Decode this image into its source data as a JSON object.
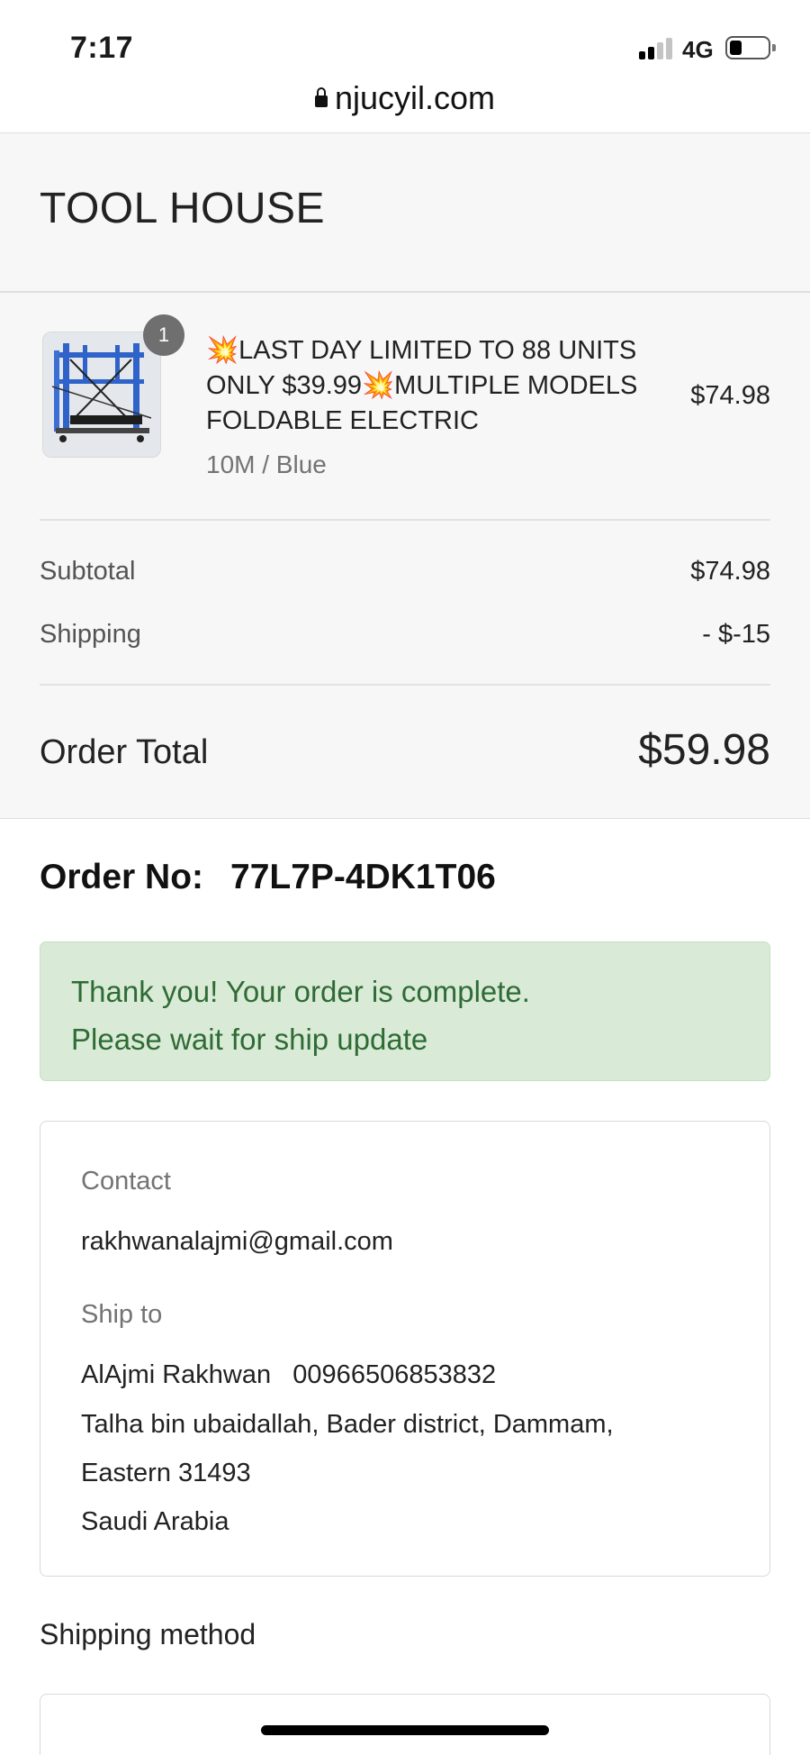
{
  "status_bar": {
    "time": "7:17",
    "network": "4G"
  },
  "browser": {
    "url": "njucyil.com",
    "lock_icon": "lock-icon"
  },
  "shop": {
    "name": "TOOL HOUSE"
  },
  "cart": {
    "item": {
      "quantity": "1",
      "title": "💥LAST DAY LIMITED TO 88 UNITS ONLY $39.99💥MULTIPLE MODELS FOLDABLE ELECTRIC",
      "variant": "10M / Blue",
      "price": "$74.98"
    },
    "subtotal_label": "Subtotal",
    "subtotal_value": "$74.98",
    "shipping_label": "Shipping",
    "shipping_value": "- $-15",
    "total_label": "Order Total",
    "total_value": "$59.98"
  },
  "order": {
    "label": "Order No:",
    "number": "77L7P-4DK1T06"
  },
  "notice": {
    "line1": "Thank you! Your order is complete.",
    "line2": "Please wait for ship update"
  },
  "contact": {
    "label": "Contact",
    "email": "rakhwanalajmi@gmail.com"
  },
  "ship_to": {
    "label": "Ship to",
    "lines": [
      "AlAjmi Rakhwan   00966506853832",
      "Talha bin ubaidallah, Bader district, Dammam,",
      "Eastern 31493",
      "Saudi Arabia"
    ]
  },
  "shipping_method": {
    "title": "Shipping method"
  },
  "colors": {
    "summary_bg": "#f7f7f7",
    "notice_bg": "#d9ebd7",
    "notice_text": "#2f6b35",
    "badge": "#6f6f6f"
  }
}
